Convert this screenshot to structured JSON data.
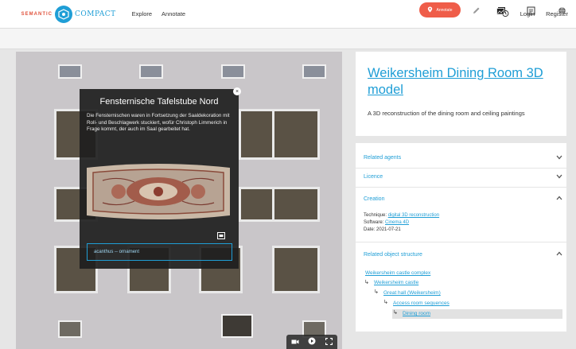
{
  "header": {
    "logo_left": "SEMANTIC",
    "logo_right": "COMPACT",
    "nav": [
      "Explore",
      "Annotate"
    ],
    "login": "Login",
    "register": "Register"
  },
  "toolbar": {
    "annotate_label": "Annotate",
    "accent": "#ef5d49"
  },
  "popup": {
    "title": "Fensternische Tafelstube Nord",
    "description": "Die Fensternischen waren in Fortsetzung der Saaldekoration mit Roll- und Beschlagwerk stuckiert, wofür Christoph Limmerich in Frage kommt, der auch im Saal gearbeitet hat.",
    "tag": "acanthus -- ornament",
    "close": "×"
  },
  "object": {
    "title": "Weikersheim Dining Room 3D model",
    "subtitle": "A 3D reconstruction of the dining room and ceiling paintings"
  },
  "accordion": {
    "related_agents": "Related agents",
    "licence": "Licence",
    "creation": "Creation",
    "technique_label": "Technique:",
    "technique_value": "digital 3D reconstruction",
    "software_label": "Software:",
    "software_value": "Cinema 4D",
    "date_label": "Date:",
    "date_value": "2021-07-21",
    "related_structure": "Related object structure"
  },
  "structure": [
    "Weikersheim castle complex",
    "Weikersheim castle",
    "Great hall (Weikersheim)",
    "Access room sequences",
    "Dining room"
  ],
  "colors": {
    "brand": "#1f9ed6",
    "logo_red": "#e0533d"
  }
}
